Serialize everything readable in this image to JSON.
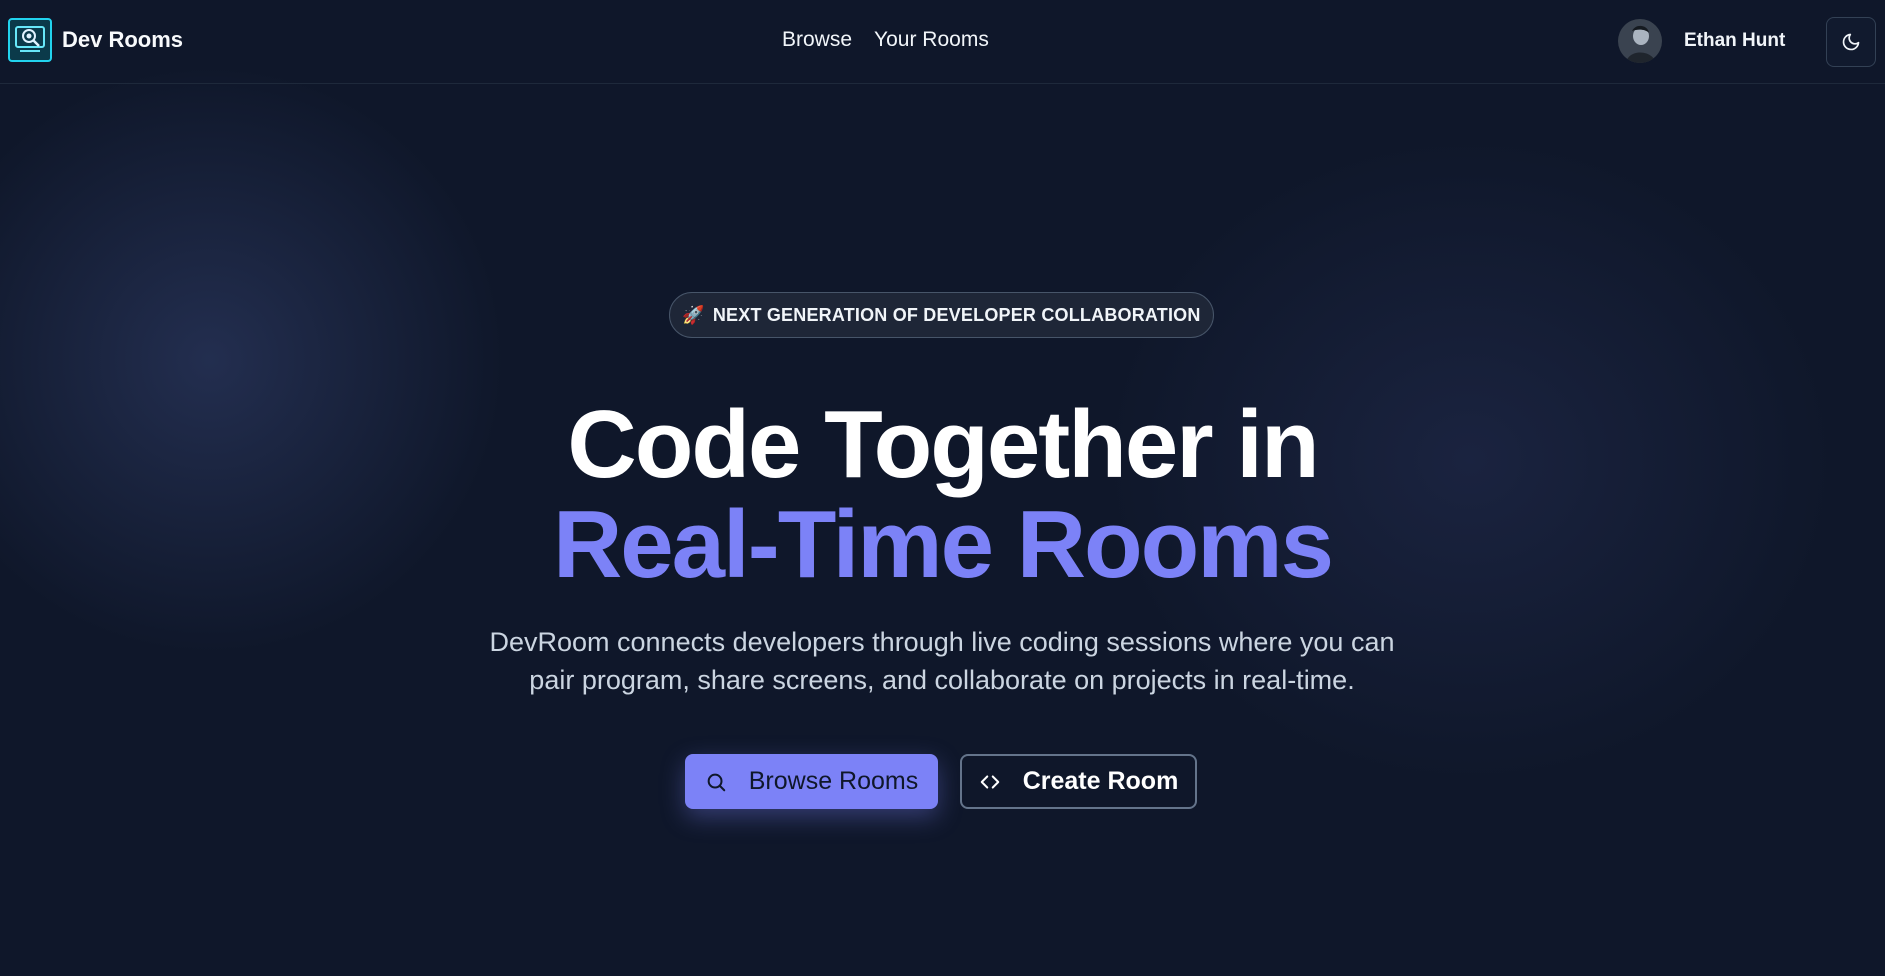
{
  "app": {
    "name": "Dev Rooms"
  },
  "nav": {
    "links": [
      {
        "label": "Browse"
      },
      {
        "label": "Your Rooms"
      }
    ]
  },
  "user": {
    "name": "Ethan Hunt"
  },
  "hero": {
    "badge_icon": "🚀",
    "badge_text": "NEXT GENERATION OF DEVELOPER COLLABORATION",
    "title_line1": "Code Together in",
    "title_line2": "Real-Time Rooms",
    "subtitle_line1": "DevRoom connects developers through live coding sessions where you can",
    "subtitle_line2": "pair program, share screens, and collaborate on projects in real-time."
  },
  "actions": {
    "browse_label": "Browse Rooms",
    "create_label": "Create Room"
  },
  "icons": {
    "logo": "magnifier-screen-logo-icon",
    "avatar": "user-avatar",
    "theme": "moon-icon",
    "browse": "search-icon",
    "create": "code-brackets-icon"
  },
  "colors": {
    "background": "#0f172a",
    "accent": "#7c82f7",
    "logo_border": "#22d3ee"
  }
}
